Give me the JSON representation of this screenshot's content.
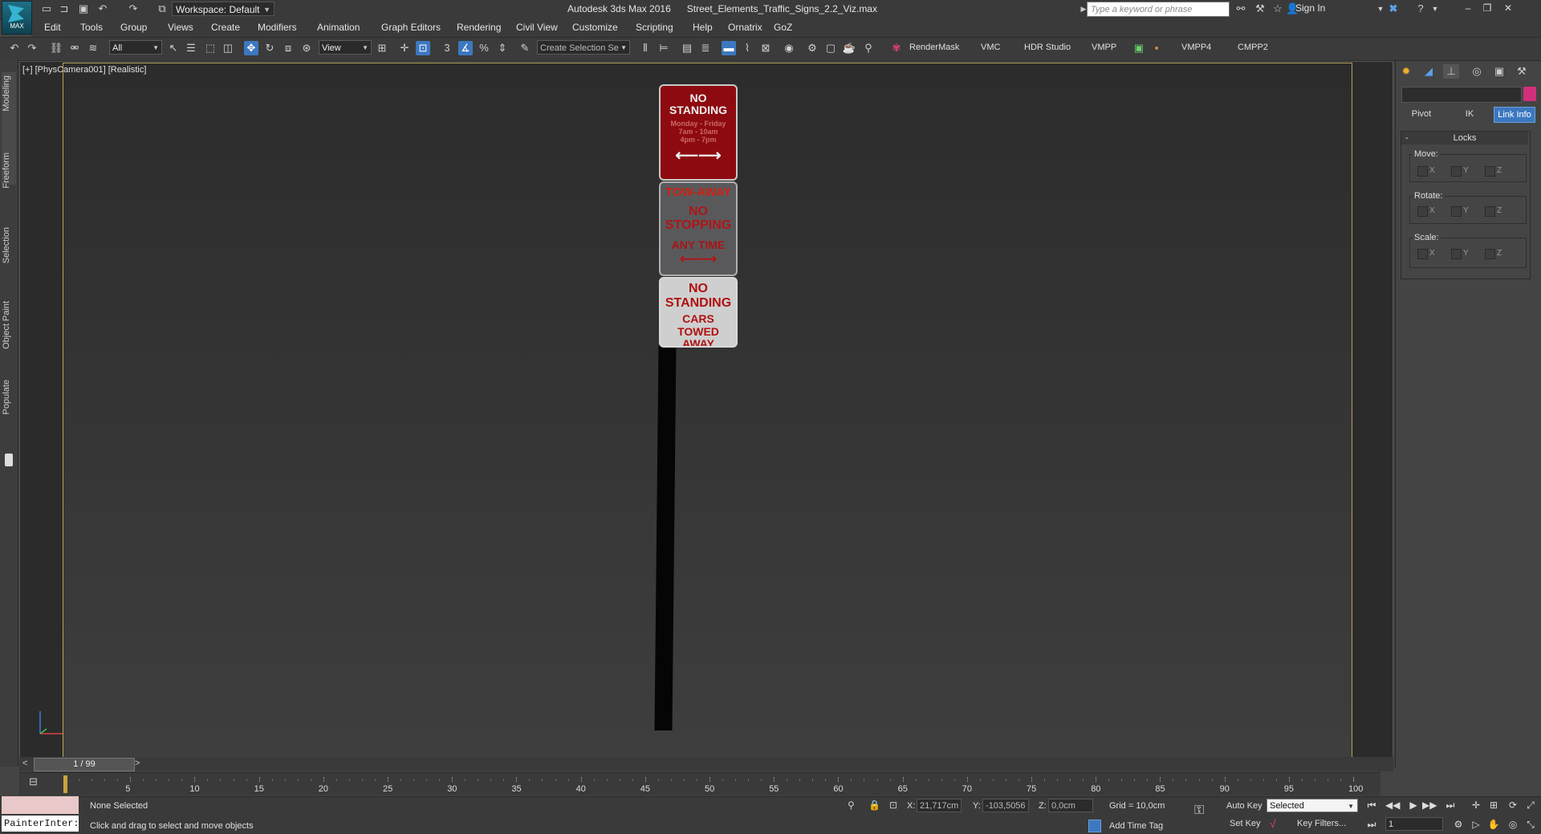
{
  "app": {
    "logo_text": "MAX",
    "workspace": "Workspace: Default",
    "title": "Autodesk 3ds Max 2016",
    "file": "Street_Elements_Traffic_Signs_2.2_Viz.max",
    "search_placeholder": "Type a keyword or phrase",
    "sign_in": "Sign In"
  },
  "menu": [
    "Edit",
    "Tools",
    "Group",
    "Views",
    "Create",
    "Modifiers",
    "Animation",
    "Graph Editors",
    "Rendering",
    "Civil View",
    "Customize",
    "Scripting",
    "Help",
    "Ornatrix",
    "GoZ"
  ],
  "toolbar": {
    "selection_filter": "All",
    "ref_coord": "View",
    "selection_set_placeholder": "Create Selection Se",
    "plugins": [
      "RenderMask",
      "VMC",
      "HDR Studio",
      "VMPP",
      "VMPP4",
      "CMPP2"
    ]
  },
  "left_tabs": [
    "Modeling",
    "Freeform",
    "Selection",
    "Object Paint",
    "Populate"
  ],
  "viewport": {
    "label": "[+] [PhysCamera001] [Realistic]",
    "signs": {
      "sign1": [
        "NO STANDING",
        "Monday - Friday",
        "7am - 10am",
        "4pm - 7pm",
        "⟵⟶"
      ],
      "sign2": [
        "TOW-AWAY",
        "NO STOPPING",
        "ANY TIME",
        "⟵⟶"
      ],
      "sign3": [
        "NO STANDING",
        "CARS",
        "TOWED AWAY",
        "⟵⟶"
      ]
    }
  },
  "command_panel": {
    "hierarchy_buttons": [
      "Pivot",
      "IK",
      "Link Info"
    ],
    "rollout_title": "Locks",
    "groups": [
      {
        "label": "Move:",
        "axes": [
          "X",
          "Y",
          "Z"
        ]
      },
      {
        "label": "Rotate:",
        "axes": [
          "X",
          "Y",
          "Z"
        ]
      },
      {
        "label": "Scale:",
        "axes": [
          "X",
          "Y",
          "Z"
        ]
      }
    ]
  },
  "timeline": {
    "frame": "1 / 99",
    "ticks": [
      "5",
      "10",
      "15",
      "20",
      "25",
      "30",
      "35",
      "40",
      "45",
      "50",
      "55",
      "60",
      "65",
      "70",
      "75",
      "80",
      "85",
      "90",
      "95",
      "100"
    ]
  },
  "status": {
    "maxscript": "PainterInter:",
    "selection": "None Selected",
    "prompt": "Click and drag to select and move objects",
    "x_label": "X:",
    "x_value": "21,717cm",
    "y_label": "Y:",
    "y_value": "-103,5056",
    "z_label": "Z:",
    "z_value": "0,0cm",
    "grid": "Grid = 10,0cm",
    "add_time_tag": "Add Time Tag",
    "auto_key": "Auto Key",
    "set_key": "Set Key",
    "key_mode": "Selected",
    "key_filters": "Key Filters...",
    "current_frame": "1"
  }
}
